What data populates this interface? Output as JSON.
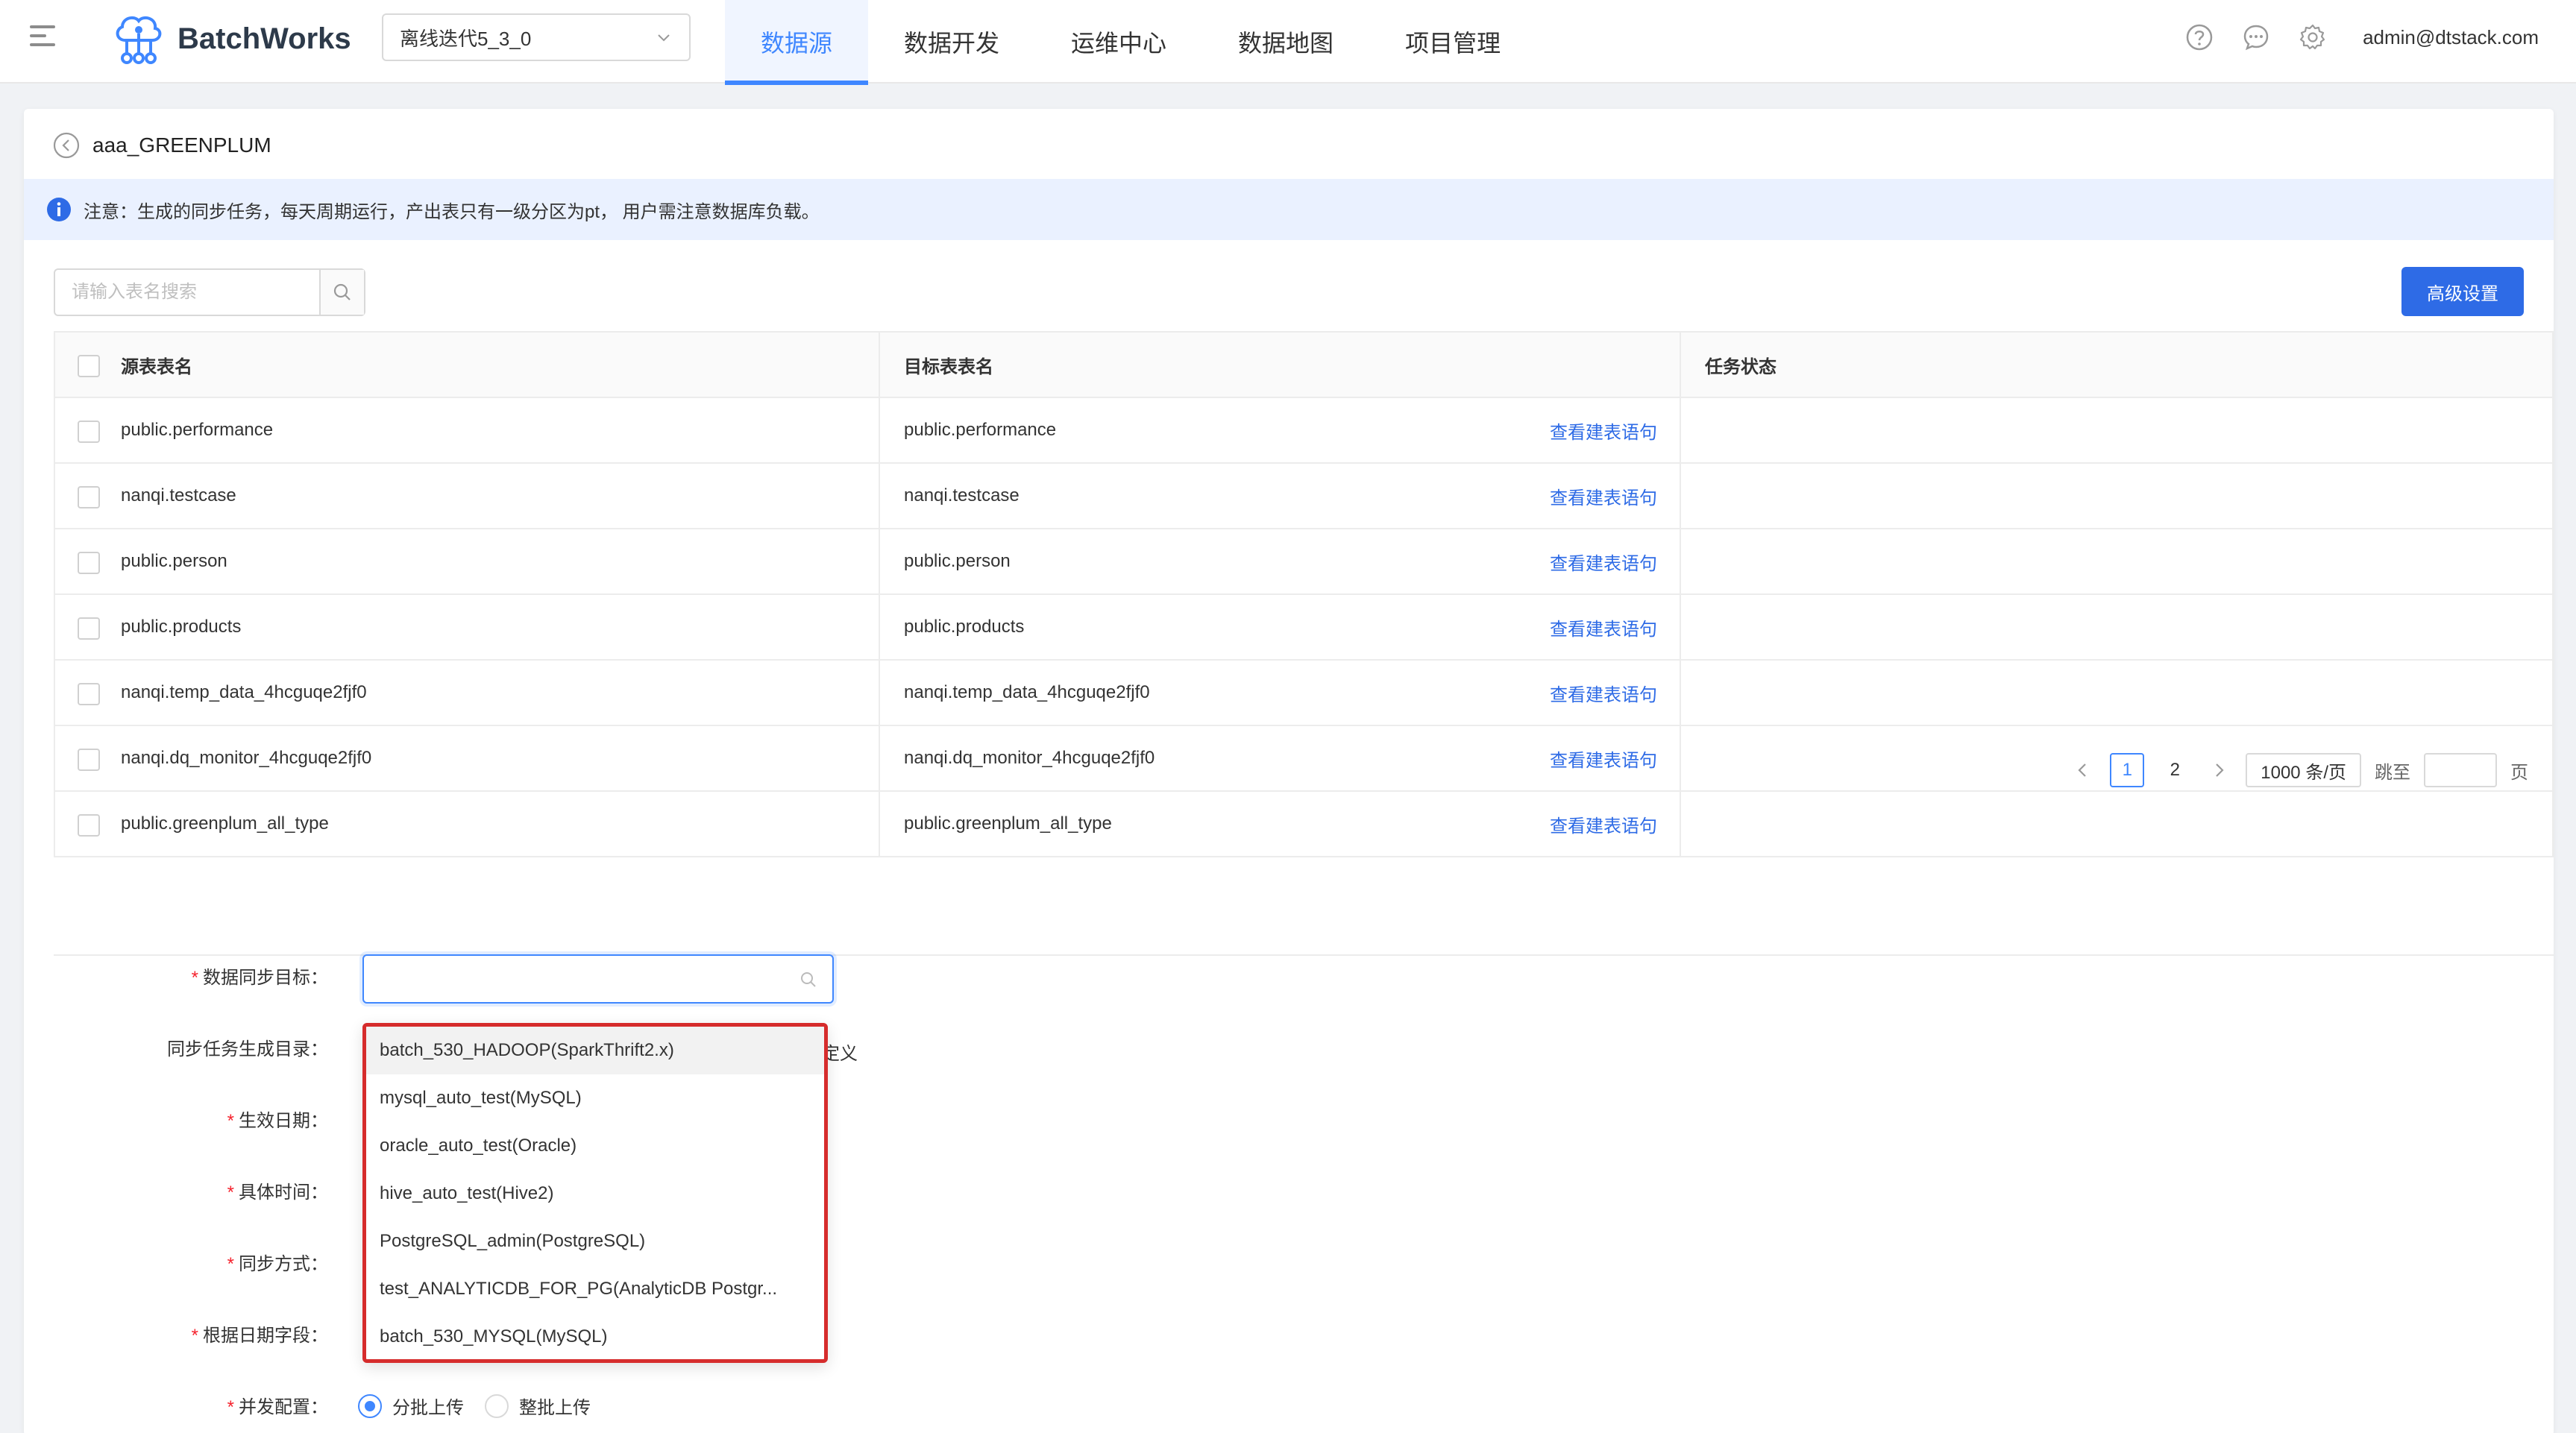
{
  "header": {
    "app_name": "BatchWorks",
    "project": "离线迭代5_3_0",
    "nav": [
      "数据源",
      "数据开发",
      "运维中心",
      "数据地图",
      "项目管理"
    ],
    "user": "admin@dtstack.com"
  },
  "page": {
    "title": "aaa_GREENPLUM",
    "notice": "注意：生成的同步任务，每天周期运行，产出表只有一级分区为pt，  用户需注意数据库负载。",
    "search_placeholder": "请输入表名搜索",
    "advanced_button": "高级设置"
  },
  "table": {
    "columns": [
      "源表表名",
      "目标表表名",
      "任务状态"
    ],
    "link_label": "查看建表语句",
    "rows": [
      {
        "source": "public.performance",
        "target": "public.performance"
      },
      {
        "source": "nanqi.testcase",
        "target": "nanqi.testcase"
      },
      {
        "source": "public.person",
        "target": "public.person"
      },
      {
        "source": "public.products",
        "target": "public.products"
      },
      {
        "source": "nanqi.temp_data_4hcguqe2fjf0",
        "target": "nanqi.temp_data_4hcguqe2fjf0"
      },
      {
        "source": "nanqi.dq_monitor_4hcguqe2fjf0",
        "target": "nanqi.dq_monitor_4hcguqe2fjf0"
      },
      {
        "source": "public.greenplum_all_type",
        "target": "public.greenplum_all_type"
      }
    ]
  },
  "pagination": {
    "pages": [
      "1",
      "2"
    ],
    "current": "1",
    "page_size": "1000 条/页",
    "jump_label": "跳至",
    "page_suffix": "页"
  },
  "form": {
    "labels": {
      "sync_target": "数据同步目标：",
      "sync_dir": "同步任务生成目录：",
      "effective_date": "生效日期：",
      "specific_time": "具体时间：",
      "sync_method": "同步方式：",
      "date_field": "根据日期字段：",
      "concurrency": "并发配置："
    },
    "dir_custom_partial": "自定义",
    "concurrency_options": [
      "分批上传",
      "整批上传"
    ],
    "concurrency_selected": "分批上传"
  },
  "dropdown": {
    "options": [
      "batch_530_HADOOP(SparkThrift2.x)",
      "mysql_auto_test(MySQL)",
      "oracle_auto_test(Oracle)",
      "hive_auto_test(Hive2)",
      "PostgreSQL_admin(PostgreSQL)",
      "test_ANALYTICDB_FOR_PG(AnalyticDB Postgr...",
      "batch_530_MYSQL(MySQL)"
    ]
  },
  "colors": {
    "primary": "#3f87ff",
    "button": "#2e6be6",
    "highlight_border": "#d62c2c",
    "notice_bg": "#eaf1ff"
  }
}
